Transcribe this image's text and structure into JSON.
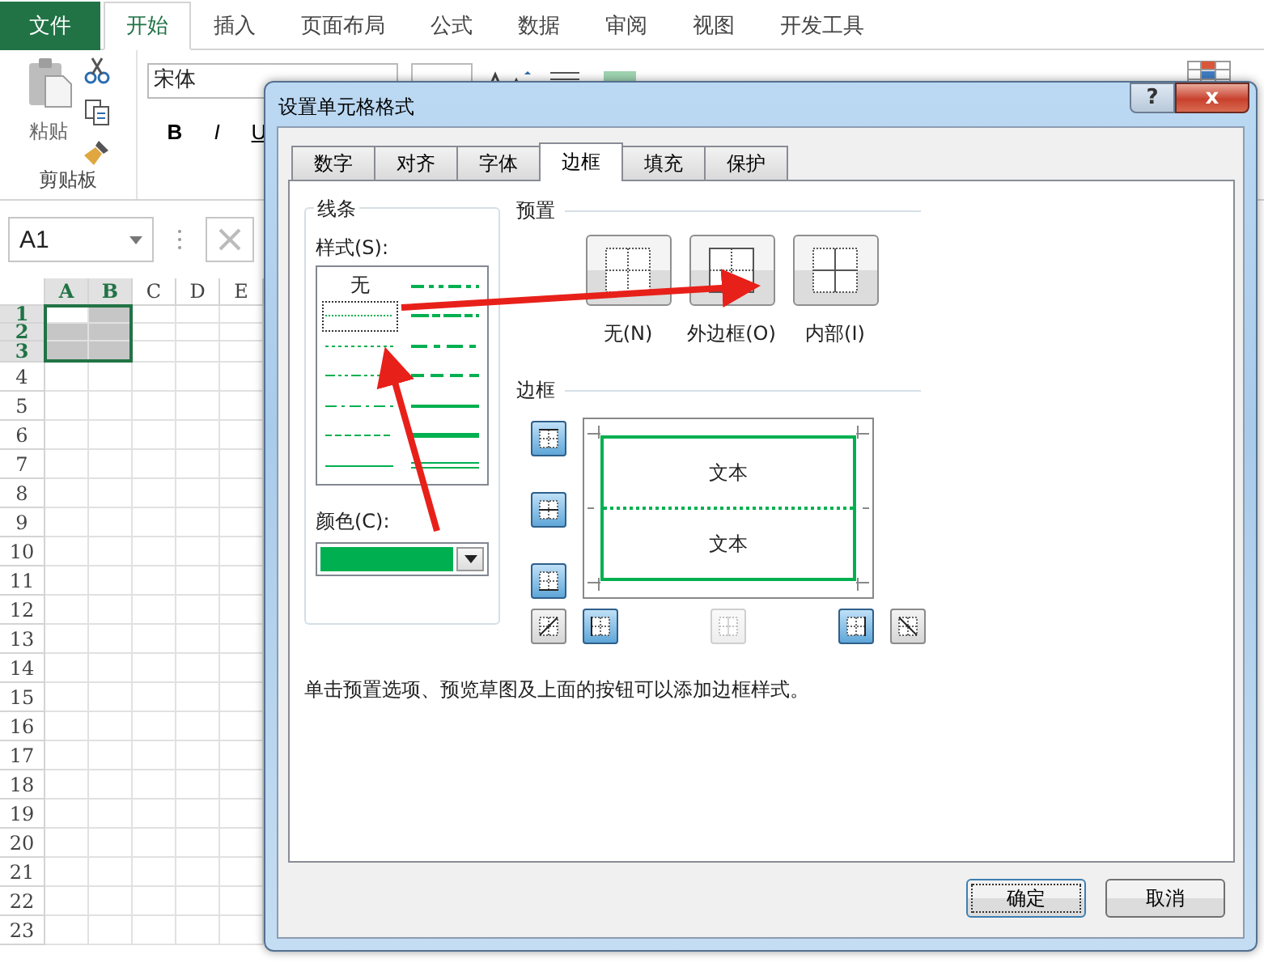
{
  "ribbon": {
    "tabs": [
      {
        "label": "文件",
        "kind": "file",
        "selected": false
      },
      {
        "label": "开始",
        "kind": "tab",
        "selected": true
      },
      {
        "label": "插入",
        "kind": "tab",
        "selected": false
      },
      {
        "label": "页面布局",
        "kind": "tab",
        "selected": false
      },
      {
        "label": "公式",
        "kind": "tab",
        "selected": false
      },
      {
        "label": "数据",
        "kind": "tab",
        "selected": false
      },
      {
        "label": "审阅",
        "kind": "tab",
        "selected": false
      },
      {
        "label": "视图",
        "kind": "tab",
        "selected": false
      },
      {
        "label": "开发工具",
        "kind": "tab",
        "selected": false
      }
    ],
    "clipboard": {
      "paste": "粘贴",
      "group": "剪贴板"
    },
    "font": {
      "name": "宋体",
      "bold": "B",
      "italic": "I",
      "underline": "U"
    }
  },
  "name_box": {
    "value": "A1"
  },
  "sheet": {
    "columns": [
      {
        "label": "A",
        "selected": true
      },
      {
        "label": "B",
        "selected": true
      },
      {
        "label": "C",
        "selected": false
      },
      {
        "label": "D",
        "selected": false
      },
      {
        "label": "E",
        "selected": false
      }
    ],
    "rows": [
      {
        "label": "1",
        "selected": true
      },
      {
        "label": "2",
        "selected": true
      },
      {
        "label": "3",
        "selected": true
      },
      {
        "label": "4",
        "selected": false
      },
      {
        "label": "5",
        "selected": false
      },
      {
        "label": "6",
        "selected": false
      },
      {
        "label": "7",
        "selected": false
      },
      {
        "label": "8",
        "selected": false
      },
      {
        "label": "9",
        "selected": false
      },
      {
        "label": "10",
        "selected": false
      },
      {
        "label": "11",
        "selected": false
      },
      {
        "label": "12",
        "selected": false
      },
      {
        "label": "13",
        "selected": false
      },
      {
        "label": "14",
        "selected": false
      },
      {
        "label": "15",
        "selected": false
      },
      {
        "label": "16",
        "selected": false
      },
      {
        "label": "17",
        "selected": false
      },
      {
        "label": "18",
        "selected": false
      },
      {
        "label": "19",
        "selected": false
      },
      {
        "label": "20",
        "selected": false
      },
      {
        "label": "21",
        "selected": false
      },
      {
        "label": "22",
        "selected": false
      },
      {
        "label": "23",
        "selected": false
      }
    ]
  },
  "dialog": {
    "title": "设置单元格格式",
    "help": "?",
    "close": "x",
    "tabs": [
      {
        "label": "数字",
        "selected": false
      },
      {
        "label": "对齐",
        "selected": false
      },
      {
        "label": "字体",
        "selected": false
      },
      {
        "label": "边框",
        "selected": true
      },
      {
        "label": "填充",
        "selected": false
      },
      {
        "label": "保护",
        "selected": false
      }
    ],
    "line": {
      "title": "线条",
      "style_label": "样式(S):",
      "color_label": "颜色(C):",
      "color": "#00b050",
      "styles": [
        {
          "kind": "none",
          "label": "无",
          "selected": false
        },
        {
          "kind": "hair",
          "selected": true
        },
        {
          "kind": "dotted",
          "selected": false
        },
        {
          "kind": "dash-dot-dot",
          "selected": false
        },
        {
          "kind": "dash-dot",
          "selected": false
        },
        {
          "kind": "dashed",
          "selected": false
        },
        {
          "kind": "thin",
          "selected": false
        },
        {
          "kind": "medium-dash-dot-dot",
          "selected": false
        },
        {
          "kind": "slant-dash-dot",
          "selected": false
        },
        {
          "kind": "medium-dash-dot",
          "selected": false
        },
        {
          "kind": "medium-dashed",
          "selected": false
        },
        {
          "kind": "medium",
          "selected": false
        },
        {
          "kind": "thick",
          "selected": false
        },
        {
          "kind": "double",
          "selected": false
        }
      ]
    },
    "presets": {
      "title": "预置",
      "items": [
        {
          "kind": "none",
          "label": "无(N)"
        },
        {
          "kind": "outline",
          "label": "外边框(O)"
        },
        {
          "kind": "inside",
          "label": "内部(I)"
        }
      ]
    },
    "border": {
      "title": "边框",
      "preview_texts": [
        "文本",
        "文本"
      ],
      "buttons": [
        {
          "kind": "top",
          "on": true,
          "disabled": false
        },
        {
          "kind": "middle-horizontal",
          "on": true,
          "disabled": false
        },
        {
          "kind": "bottom",
          "on": true,
          "disabled": false
        },
        {
          "kind": "diagonal-up",
          "on": false,
          "disabled": false
        },
        {
          "kind": "left",
          "on": true,
          "disabled": false
        },
        {
          "kind": "middle-vertical",
          "on": false,
          "disabled": true
        },
        {
          "kind": "right",
          "on": true,
          "disabled": false
        },
        {
          "kind": "diagonal-down",
          "on": false,
          "disabled": false
        }
      ]
    },
    "hint": "单击预置选项、预览草图及上面的按钮可以添加边框样式。",
    "buttons": [
      {
        "label": "确定",
        "default": true
      },
      {
        "label": "取消",
        "default": false
      }
    ]
  }
}
